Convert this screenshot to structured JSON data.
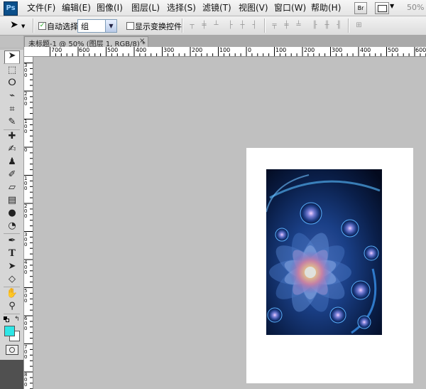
{
  "app": {
    "logo": "Ps"
  },
  "menu": {
    "items": [
      "文件(F)",
      "编辑(E)",
      "图像(I)",
      "图层(L)",
      "选择(S)",
      "滤镜(T)",
      "视图(V)",
      "窗口(W)",
      "帮助(H)"
    ],
    "bridge_label": "Br",
    "zoom": "50%"
  },
  "options": {
    "auto_select_label": "自动选择:",
    "auto_select_value": "组",
    "show_transform_label": "显示变换控件"
  },
  "document": {
    "tab_title": "未标题-1 @ 50% (图层 1, RGB/8) *",
    "close_symbol": "×"
  },
  "ruler": {
    "top_labels": [
      "700",
      "600",
      "500",
      "400",
      "300",
      "200",
      "100",
      "0",
      "100",
      "200",
      "300",
      "400",
      "500",
      "600"
    ],
    "left_labels": [
      "300",
      "200",
      "100",
      "0",
      "100",
      "200",
      "300",
      "400",
      "500",
      "600",
      "700",
      "800"
    ]
  },
  "tools": [
    "move",
    "marquee",
    "lasso",
    "quick-select",
    "crop",
    "eyedropper",
    "healing-brush",
    "brush",
    "clone-stamp",
    "history-brush",
    "eraser",
    "gradient",
    "blur",
    "dodge",
    "pen",
    "type",
    "path-select",
    "shape",
    "hand",
    "zoom"
  ],
  "colors": {
    "foreground": "#2ee6e6",
    "background": "#ffffff",
    "workspace": "#c0c0c0"
  }
}
